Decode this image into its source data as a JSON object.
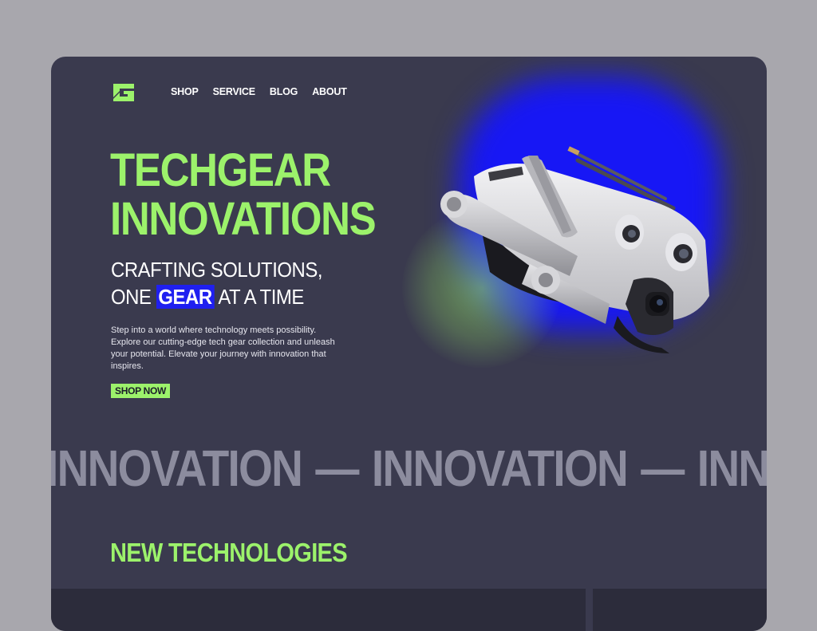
{
  "brand": {
    "logo_icon": "g-monogram-logo",
    "accent_color": "#9cf26b",
    "highlight_color": "#1f1ff0"
  },
  "nav": {
    "items": [
      {
        "label": "SHOP"
      },
      {
        "label": "SERVICE"
      },
      {
        "label": "BLOG"
      },
      {
        "label": "ABOUT"
      }
    ]
  },
  "hero": {
    "title_line1": "TECHGEAR",
    "title_line2": "INNOVATIONS",
    "subtitle_line1": "CRAFTING SOLUTIONS,",
    "subtitle_line2_before": "ONE",
    "subtitle_line2_highlight": "GEAR",
    "subtitle_line2_after": "AT A TIME",
    "description": "Step into a world where technology meets possibility. Explore our cutting-edge tech gear collection and unleash your potential. Elevate your journey with innovation that inspires.",
    "cta_label": "SHOP NOW",
    "image_icon": "drone-image"
  },
  "marquee": {
    "words": [
      "INNOVATION",
      "INNOVATION",
      "INNOVATION"
    ],
    "separator": "—"
  },
  "section": {
    "title": "NEW TECHNOLOGIES"
  }
}
